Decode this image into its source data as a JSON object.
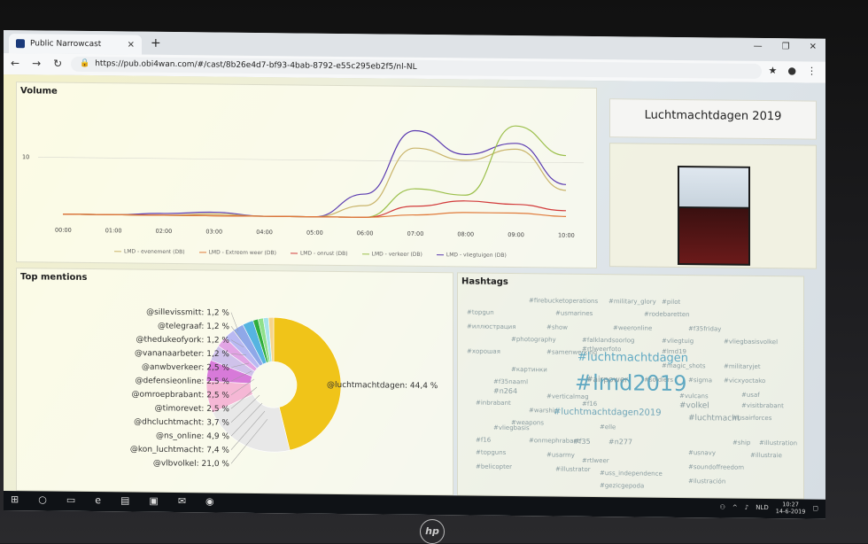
{
  "browser": {
    "tab_title": "Public Narrowcast",
    "url": "https://pub.obi4wan.com/#/cast/8b26e4d7-bf93-4bab-8792-e55c295eb2f5/nl-NL"
  },
  "volume": {
    "title": "Volume",
    "y_tick": "10",
    "x_ticks": [
      "00:00",
      "01:00",
      "02:00",
      "03:00",
      "04:00",
      "05:00",
      "06:00",
      "07:00",
      "08:00",
      "09:00",
      "10:00"
    ],
    "legend": [
      {
        "name": "LMD - evenement (DB)",
        "color": "#c9b46a"
      },
      {
        "name": "LMD - Extreem weer (DB)",
        "color": "#e07a3a"
      },
      {
        "name": "LMD - onrust (DB)",
        "color": "#d23a3a"
      },
      {
        "name": "LMD - verkeer (DB)",
        "color": "#9bbf4a"
      },
      {
        "name": "LMD - vliegtuigen (DB)",
        "color": "#5a3ab0"
      }
    ]
  },
  "chart_data": {
    "type": "line",
    "title": "Volume",
    "x": [
      "00:00",
      "01:00",
      "02:00",
      "03:00",
      "04:00",
      "05:00",
      "06:00",
      "07:00",
      "08:00",
      "09:00",
      "10:00"
    ],
    "ylim": [
      0,
      18
    ],
    "series": [
      {
        "name": "LMD - vliegtuigen (DB)",
        "color": "#5a3ab0",
        "values": [
          0,
          0,
          0.3,
          0.6,
          0,
          0,
          4,
          15,
          11,
          13,
          6
        ]
      },
      {
        "name": "LMD - evenement (DB)",
        "color": "#c9b46a",
        "values": [
          0,
          0,
          0,
          0.3,
          0,
          0,
          2,
          12,
          10,
          12,
          5
        ]
      },
      {
        "name": "LMD - verkeer (DB)",
        "color": "#9bbf4a",
        "values": [
          0,
          0,
          0,
          0,
          0,
          0,
          0,
          5,
          4,
          16,
          11
        ]
      },
      {
        "name": "LMD - onrust (DB)",
        "color": "#d23a3a",
        "values": [
          0,
          0,
          0,
          0,
          0,
          0,
          0,
          2,
          3,
          2.5,
          1.5
        ]
      },
      {
        "name": "LMD - Extreem weer (DB)",
        "color": "#e07a3a",
        "values": [
          0,
          0,
          0,
          0,
          0,
          0,
          0,
          0.5,
          1,
          1,
          0.5
        ]
      }
    ]
  },
  "event_title": "Luchtmachtdagen 2019",
  "mentions": {
    "title": "Top mentions",
    "items": [
      {
        "handle": "@luchtmachtdagen",
        "pct": "44,4 %",
        "value": 44.4,
        "color": "#f0c419"
      },
      {
        "handle": "@vlbvolkel",
        "pct": "21,0 %",
        "value": 21.0,
        "color": "#e8e8e8"
      },
      {
        "handle": "@kon_luchtmacht",
        "pct": "7,4 %",
        "value": 7.4,
        "color": "#f5b7d5"
      },
      {
        "handle": "@ns_online",
        "pct": "4,9 %",
        "value": 4.9,
        "color": "#d77ad9"
      },
      {
        "handle": "@dhcluchtmacht",
        "pct": "3,7 %",
        "value": 3.7,
        "color": "#cfc2ea"
      },
      {
        "handle": "@timorevet",
        "pct": "2,5 %",
        "value": 2.5,
        "color": "#e2a4e4"
      },
      {
        "handle": "@omroepbrabant",
        "pct": "2,5 %",
        "value": 2.5,
        "color": "#b9b9f2"
      },
      {
        "handle": "@defensieonline",
        "pct": "2,5 %",
        "value": 2.5,
        "color": "#8fa8e8"
      },
      {
        "handle": "@anwbverkeer",
        "pct": "2,5 %",
        "value": 2.5,
        "color": "#56b4e0"
      },
      {
        "handle": "@vananaarbeter",
        "pct": "1,2 %",
        "value": 1.2,
        "color": "#2fae3c"
      },
      {
        "handle": "@thedukeofyork",
        "pct": "1,2 %",
        "value": 1.2,
        "color": "#8fe08a"
      },
      {
        "handle": "@telegraaf",
        "pct": "1,2 %",
        "value": 1.2,
        "color": "#a6e3ea"
      },
      {
        "handle": "@sillevissmitt",
        "pct": "1,2 %",
        "value": 1.2,
        "color": "#f6d48a"
      }
    ]
  },
  "hashtags": {
    "title": "Hashtags",
    "tags": [
      {
        "t": "#firebucketoperations",
        "s": 7
      },
      {
        "t": "#military_glory",
        "s": 7
      },
      {
        "t": "#pilot",
        "s": 7
      },
      {
        "t": "#topgun",
        "s": 7
      },
      {
        "t": "#usmarines",
        "s": 7
      },
      {
        "t": "#rodebaretten",
        "s": 7
      },
      {
        "t": "#иллюстрация",
        "s": 7
      },
      {
        "t": "#show",
        "s": 7
      },
      {
        "t": "#weeronline",
        "s": 7
      },
      {
        "t": "#f35friday",
        "s": 7
      },
      {
        "t": "#photography",
        "s": 7
      },
      {
        "t": "#falklandsoorlog",
        "s": 7
      },
      {
        "t": "#vliegtuig",
        "s": 7
      },
      {
        "t": "#vliegbasisvolkel",
        "s": 7
      },
      {
        "t": "#хорошая",
        "s": 7
      },
      {
        "t": "#samenwerking",
        "s": 7
      },
      {
        "t": "#rtlweerfoto",
        "s": 7
      },
      {
        "t": "#lmd19",
        "s": 7
      },
      {
        "t": "#lmd2019",
        "s": 24
      },
      {
        "t": "#luchtmachtdagen",
        "s": 13
      },
      {
        "t": "#картинки",
        "s": 7
      },
      {
        "t": "#magic_shots",
        "s": 7
      },
      {
        "t": "#militaryjet",
        "s": 7
      },
      {
        "t": "#f35naaml",
        "s": 7
      },
      {
        "t": "#airpower",
        "s": 9
      },
      {
        "t": "#soldiers",
        "s": 7
      },
      {
        "t": "#sigma",
        "s": 7
      },
      {
        "t": "#vicxyoctako",
        "s": 7
      },
      {
        "t": "#n264",
        "s": 8
      },
      {
        "t": "#vulcans",
        "s": 7
      },
      {
        "t": "#usaf",
        "s": 7
      },
      {
        "t": "#verticalmag",
        "s": 7
      },
      {
        "t": "#f16",
        "s": 7
      },
      {
        "t": "#volkel",
        "s": 9
      },
      {
        "t": "#visitbrabant",
        "s": 7
      },
      {
        "t": "#inbrabant",
        "s": 7
      },
      {
        "t": "#warship",
        "s": 7
      },
      {
        "t": "#luchtmachtdagen2019",
        "s": 10
      },
      {
        "t": "#weapons",
        "s": 7
      },
      {
        "t": "#luchtmacht",
        "s": 9
      },
      {
        "t": "#usairforces",
        "s": 7
      },
      {
        "t": "#elle",
        "s": 7
      },
      {
        "t": "#vliegbasis",
        "s": 7
      },
      {
        "t": "#f16",
        "s": 7
      },
      {
        "t": "#topguns",
        "s": 7
      },
      {
        "t": "#onmephrabant",
        "s": 7
      },
      {
        "t": "#f35",
        "s": 8
      },
      {
        "t": "#n277",
        "s": 8
      },
      {
        "t": "#ship",
        "s": 7
      },
      {
        "t": "#illustration",
        "s": 7
      },
      {
        "t": "#belicopter",
        "s": 7
      },
      {
        "t": "#usnavy",
        "s": 7
      },
      {
        "t": "#illustraie",
        "s": 7
      },
      {
        "t": "#usarmy",
        "s": 7
      },
      {
        "t": "#rtlweer",
        "s": 7
      },
      {
        "t": "#soundoffreedom",
        "s": 7
      },
      {
        "t": "#illustrator",
        "s": 7
      },
      {
        "t": "#uss_independence",
        "s": 7
      },
      {
        "t": "#ilustración",
        "s": 7
      },
      {
        "t": "#gezicgepoda",
        "s": 7
      }
    ]
  },
  "taskbar": {
    "language": "NLD",
    "time": "10:27",
    "date": "14-6-2019"
  },
  "brand": "hp"
}
